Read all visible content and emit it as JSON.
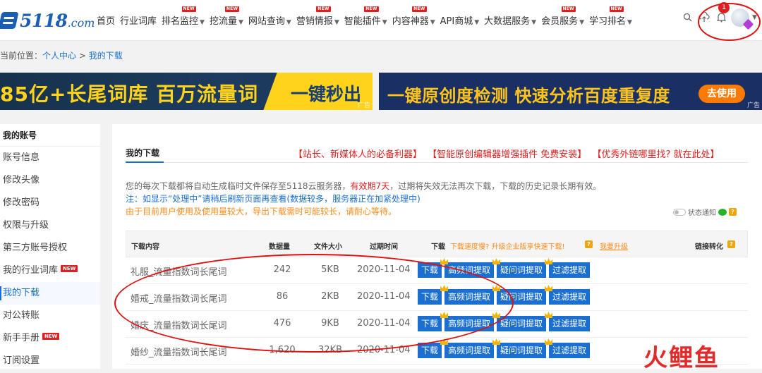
{
  "header": {
    "logo_text": "5118",
    "logo_domain": ".com",
    "nav": [
      {
        "label": "首页",
        "new": false,
        "dropdown": false
      },
      {
        "label": "行业词库",
        "new": false,
        "dropdown": false
      },
      {
        "label": "排名监控",
        "new": true,
        "dropdown": true
      },
      {
        "label": "挖流量",
        "new": true,
        "dropdown": true
      },
      {
        "label": "网站查询",
        "new": false,
        "dropdown": true
      },
      {
        "label": "营销情报",
        "new": true,
        "dropdown": true
      },
      {
        "label": "智能插件",
        "new": true,
        "dropdown": true
      },
      {
        "label": "内容神器",
        "new": true,
        "dropdown": true
      },
      {
        "label": "API商城",
        "new": false,
        "dropdown": true
      },
      {
        "label": "大数据服务",
        "new": false,
        "dropdown": true
      },
      {
        "label": "会员服务",
        "new": true,
        "dropdown": true
      },
      {
        "label": "学习排名",
        "new": true,
        "dropdown": true
      }
    ],
    "new_tag": "NEW",
    "notification_count": "1",
    "icons": [
      "search-icon",
      "cloud-upload-icon",
      "bell-icon",
      "avatar"
    ]
  },
  "breadcrumb": {
    "prefix": "当前位置：",
    "items": [
      "个人中心",
      "我的下载"
    ],
    "separator": " > "
  },
  "ads": {
    "left_title_a": "85亿+长尾词库 百万流量词",
    "left_title_b": "一键秒出",
    "left_tag": "广告",
    "right_title": "一键原创度检测 快速分析百度重复度",
    "right_button": "去使用",
    "right_tag": "广告"
  },
  "sidebar": {
    "heading": "我的账号",
    "items": [
      {
        "label": "账号信息",
        "active": false,
        "new": false
      },
      {
        "label": "修改头像",
        "active": false,
        "new": false
      },
      {
        "label": "修改密码",
        "active": false,
        "new": false
      },
      {
        "label": "权限与升级",
        "active": false,
        "new": false
      },
      {
        "label": "第三方账号授权",
        "active": false,
        "new": false
      },
      {
        "label": "我的行业词库",
        "active": false,
        "new": true
      },
      {
        "label": "我的下载",
        "active": true,
        "new": false
      },
      {
        "label": "对公转账",
        "active": false,
        "new": false
      },
      {
        "label": "新手手册",
        "active": false,
        "new": true
      },
      {
        "label": "订阅设置",
        "active": false,
        "new": false
      }
    ]
  },
  "main": {
    "title": "我的下载",
    "promos": [
      "【站长、新媒体人的必备利器】",
      "【智能原创编辑器增强插件 免费安装】",
      "【优秀外链哪里找? 就在此处】"
    ],
    "info1_a": "您的每次下载都将自动生成临时文件保存至5118云服务器，",
    "info1_em": "有效期7天",
    "info1_b": "，过期将失效无法再次下载，下载的历史记录长期有效。",
    "info2": "注：如显示“处理中”请稍后刷新页面再查看(数据较多，服务器正在加紧处理中)",
    "info3": "由于目前用户使用及使用量较大，导出下载需时可能较长，请耐心等待。",
    "notify_label": "状态通知"
  },
  "table": {
    "headers": {
      "name": "下载内容",
      "count": "数据量",
      "size": "文件大小",
      "expire": "过期时间",
      "download": "下载",
      "hot_tip": "下载速度慢? 升级企业版享快速下载!",
      "upgrade": "我要升级",
      "convert": "链接转化"
    },
    "buttons": [
      "下载",
      "高频词提取",
      "疑问词提取",
      "过滤提取"
    ],
    "rows": [
      {
        "name": "礼服_流量指数词长尾词",
        "count": "242",
        "size": "5KB",
        "expire": "2020-11-04"
      },
      {
        "name": "婚戒_流量指数词长尾词",
        "count": "86",
        "size": "2KB",
        "expire": "2020-11-04"
      },
      {
        "name": "婚庆_流量指数词长尾词",
        "count": "476",
        "size": "9KB",
        "expire": "2020-11-04"
      },
      {
        "name": "婚纱_流量指数词长尾词",
        "count": "1,620",
        "size": "32KB",
        "expire": "2020-11-04"
      }
    ]
  },
  "watermark": "火鲤鱼",
  "colors": {
    "accent": "#1a6fd0",
    "alert": "#e02020",
    "warn": "#ff8c1a",
    "brand": "#1a5fb4"
  }
}
